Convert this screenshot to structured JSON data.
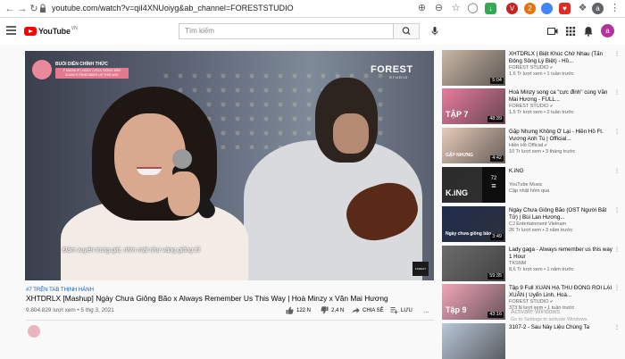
{
  "browser": {
    "url": "youtube.com/watch?v=qiI4XNUoiyg&ab_channel=FORESTSTUDIO",
    "ext_badge_1": "V",
    "ext_badge_2": "2",
    "profile_letter": "a"
  },
  "header": {
    "logo_text": "YouTube",
    "country": "VN",
    "search_placeholder": "Tìm kiếm",
    "avatar_letter": "a"
  },
  "player": {
    "badge_title": "BUỔI DIỄN CHÍNH THỨC",
    "badge_sub": "F MASHUP | NGÀY CHƯA GIÔNG BÃO ALWAYS REMEMBER US THIS WAY",
    "brand": "FOREST",
    "brand_sub": "STUDIO",
    "subtitle": "Đâm xuyên trong gió, nhìn mặt như vàng giông tố",
    "watermark": "FOREST"
  },
  "video": {
    "hashtag": "#7 TRÊN TAB THỊNH HÀNH",
    "title": "XHTDRLX [Mashup] Ngày Chưa Giông Bão x Always Remember Us This Way | Hoà Minzy x Văn Mai Hương",
    "views": "9.804.829 lượt xem • 5 thg 3, 2021",
    "likes": "122 N",
    "dislikes": "2,4 N",
    "share": "CHIA SẺ",
    "save": "LƯU",
    "more": "..."
  },
  "sidebar": [
    {
      "title": "XHTDRLX | Biệt Khúc Chờ Nhau (Tấn Đông Sông Lý Biệt) - Hồ...",
      "channel": "FOREST STUDIO",
      "meta": "1,6 Tr lượt xem • 1 tuần trước",
      "duration": "5:04",
      "verified": true,
      "color": "#c9b7a5"
    },
    {
      "title": "Hoà Minzy song ca \"cực đỉnh\" cùng Văn Mai Hương - FULL...",
      "channel": "FOREST STUDIO",
      "meta": "1,5 Tr lượt xem • 2 tuần trước",
      "duration": "48:39",
      "verified": true,
      "color": "#e97a9e",
      "overlay": "TẬP 7"
    },
    {
      "title": "Gặp Nhưng Không Ở Lại - Hiền Hồ Ft. Vương Anh Tú | Official...",
      "channel": "Hiền Hồ Official",
      "meta": "10 Tr lượt xem • 3 tháng trước",
      "duration": "4:42",
      "verified": true,
      "color": "#e6cbb8",
      "overlay": "GẶP NHƯNG"
    },
    {
      "title": "K.iNG",
      "channel": "YouTube Music",
      "meta": "Cập nhật hôm qua",
      "count": "72",
      "verified": false,
      "color": "#2b2b2b",
      "overlay": "K.iNG"
    },
    {
      "title": "Ngày Chưa Giông Bão (OST Người Bất Tử) | Bùi Lan Hương...",
      "channel": "CJ Entertainment Vietnam",
      "meta": "26 Tr lượt xem • 3 năm trước",
      "duration": "3:49",
      "verified": false,
      "color": "#1f2c4e",
      "overlay": "Ngày chưa giông bão"
    },
    {
      "title": "Lady gaga - Always remember us this way 1 Hour",
      "channel": "TKSNM",
      "meta": "8,6 Tr lượt xem • 1 năm trước",
      "duration": "59:35",
      "verified": false,
      "color": "#6b6b6b"
    },
    {
      "title": "Tập 9 Full XUÂN HẠ THU ĐÔNG RỒI LẠI XUÂN | Uyển Linh, Hoà...",
      "channel": "FOREST STUDIO",
      "meta": "373 N lượt xem • 1 tuần trước",
      "duration": "43:16",
      "verified": true,
      "color": "#f1a5b8",
      "overlay": "Tập 9"
    },
    {
      "title": "3107-2 - Sau Này Liệu Chúng Ta",
      "channel": "",
      "meta": "",
      "duration": "",
      "verified": false,
      "color": "#b9c7d8"
    }
  ],
  "windows_watermark": [
    "Activate Windows",
    "Go to Settings to activate Windows."
  ],
  "colors": {
    "brand_red": "#ff0000",
    "link_blue": "#065fd4",
    "avatar": "#b0339a"
  }
}
